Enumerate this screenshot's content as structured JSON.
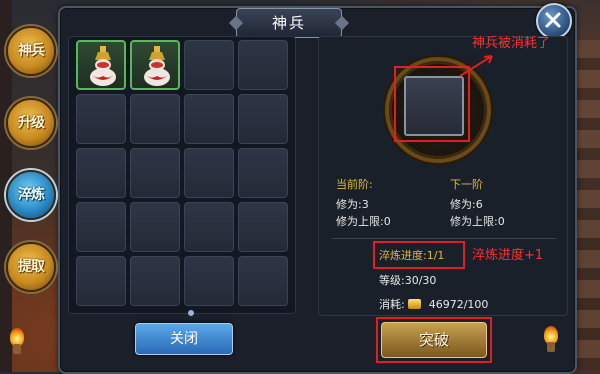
{
  "window": {
    "title": "神兵"
  },
  "tabs": [
    {
      "label": "神兵",
      "active": false
    },
    {
      "label": "升级",
      "active": false
    },
    {
      "label": "淬炼",
      "active": true
    },
    {
      "label": "提取",
      "active": false
    }
  ],
  "inventory": {
    "columns": 4,
    "rows": 5,
    "filled_slots": 2,
    "page_indicator": "1"
  },
  "buttons": {
    "close_label": "关闭",
    "breakthrough_label": "突破"
  },
  "detail": {
    "current_stage_title": "当前阶:",
    "current_cultivation": "修为:3",
    "current_cap": "修为上限:0",
    "next_stage_title": "下一阶",
    "next_cultivation": "修为:6",
    "next_cap": "修为上限:0",
    "temper_progress": "淬炼进度:1/1",
    "level": "等级:30/30",
    "cost_label": "消耗:",
    "cost_value": "46972/100"
  },
  "annotations": {
    "consumed_note": "神兵被消耗了",
    "progress_note": "淬炼进度+1"
  },
  "colors": {
    "annotation_red": "#e02020",
    "gold_text": "#e0b840",
    "active_tab": "#2a8ac8",
    "filled_slot_border": "#5ab85a"
  },
  "icons": [
    "close-x-icon",
    "gourd-item-icon",
    "gold-coin-icon",
    "torch-icon"
  ]
}
